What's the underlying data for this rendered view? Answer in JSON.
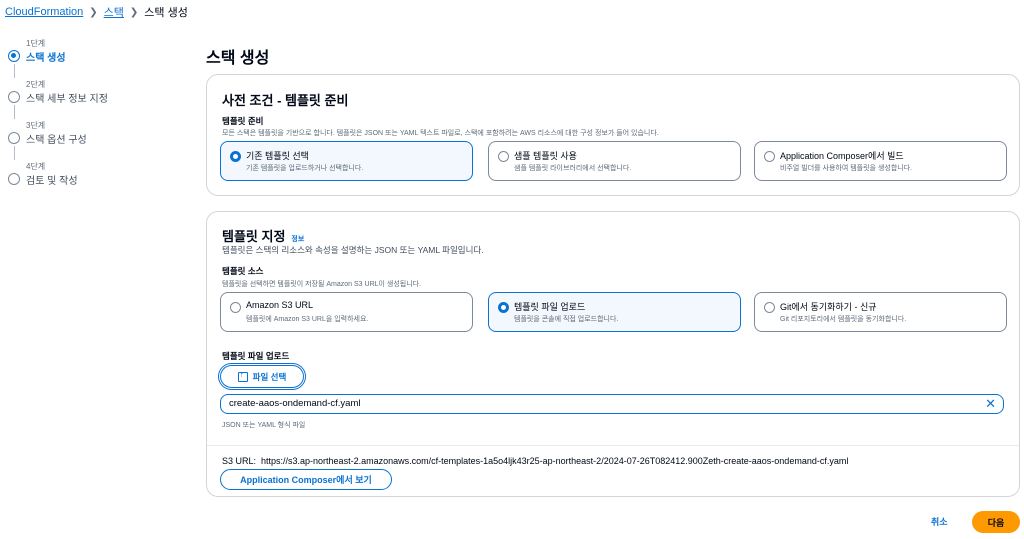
{
  "breadcrumb": {
    "items": [
      "CloudFormation",
      "스택",
      "스택 생성"
    ]
  },
  "steps": [
    {
      "num": "1단계",
      "label": "스택 생성",
      "active": true
    },
    {
      "num": "2단계",
      "label": "스택 세부 정보 지정",
      "active": false
    },
    {
      "num": "3단계",
      "label": "스택 옵션 구성",
      "active": false
    },
    {
      "num": "4단계",
      "label": "검토 및 작성",
      "active": false
    }
  ],
  "page_title": "스택 생성",
  "prereq": {
    "title": "사전 조건 - 템플릿 준비",
    "field_label": "템플릿 준비",
    "field_desc": "모든 스택은 템플릿을 기반으로 합니다. 템플릿은 JSON 또는 YAML 텍스트 파일로, 스택에 포함하려는 AWS 리소스에 대한 구성 정보가 들어 있습니다.",
    "options": [
      {
        "label": "기존 템플릿 선택",
        "desc": "기존 템플릿을 업로드하거나 선택합니다.",
        "selected": true
      },
      {
        "label": "샘플 템플릿 사용",
        "desc": "샘플 템플릿 라이브러리에서 선택합니다.",
        "selected": false
      },
      {
        "label": "Application Composer에서 빌드",
        "desc": "비주얼 빌더를 사용하여 템플릿을 생성합니다.",
        "selected": false
      }
    ]
  },
  "template": {
    "title": "템플릿 지정",
    "info": "정보",
    "desc": "템플릿은 스택의 리소스와 속성을 설명하는 JSON 또는 YAML 파일입니다.",
    "source_label": "템플릿 소스",
    "source_desc": "템플릿을 선택하면 템플릿이 저장될 Amazon S3 URL이 생성됩니다.",
    "sources": [
      {
        "label": "Amazon S3 URL",
        "desc": "템플릿에 Amazon S3 URL을 입력하세요.",
        "selected": false
      },
      {
        "label": "템플릿 파일 업로드",
        "desc": "템플릿을 콘솔에 직접 업로드합니다.",
        "selected": true
      },
      {
        "label": "Git에서 동기화하기 - 신규",
        "desc": "Git 리포지토리에서 템플릿을 동기화합니다.",
        "selected": false
      }
    ],
    "upload_label": "템플릿 파일 업로드",
    "choose_file": "파일 선택",
    "file_name": "create-aaos-ondemand-cf.yaml",
    "file_hint": "JSON 또는 YAML 형식 파일",
    "s3_label": "S3 URL:",
    "s3_url": "https://s3.ap-northeast-2.amazonaws.com/cf-templates-1a5o4ljk43r25-ap-northeast-2/2024-07-26T082412.900Zeth-create-aaos-ondemand-cf.yaml",
    "view_composer": "Application Composer에서 보기"
  },
  "footer": {
    "cancel": "취소",
    "next": "다음"
  },
  "colors": {
    "link": "#0972d3",
    "primary_button": "#ff9900",
    "selected_bg": "#f2f8fd"
  }
}
